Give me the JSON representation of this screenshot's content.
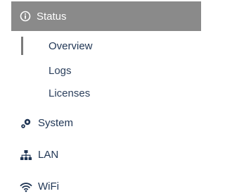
{
  "nav": {
    "status": {
      "label": "Status",
      "icon": "info-circle-icon",
      "background": "#8a8a8a",
      "items": [
        {
          "label": "Overview",
          "active": true
        },
        {
          "label": "Logs"
        },
        {
          "label": "Licenses"
        }
      ]
    },
    "system": {
      "label": "System",
      "icon": "gears-icon"
    },
    "lan": {
      "label": "LAN",
      "icon": "network-tree-icon"
    },
    "wifi": {
      "label": "WiFi",
      "icon": "wifi-icon"
    }
  }
}
